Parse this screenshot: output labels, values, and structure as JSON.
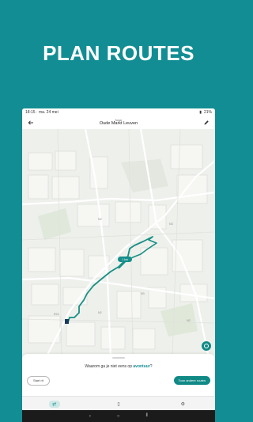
{
  "headline": "PLAN ROUTES",
  "statusbar": {
    "left": "18:15 · ma. 24 mei",
    "right": "21%"
  },
  "appbar": {
    "subtitle": "Naar",
    "title": "Oude Markt Leuven"
  },
  "map": {
    "route_badge": "1 km",
    "labels": [
      "N2",
      "N3",
      "N3",
      "N2",
      "N2",
      "R23"
    ]
  },
  "sheet": {
    "question_prefix": "Waarom ga je niet eens op ",
    "question_accent": "avontuur",
    "question_suffix": "?",
    "start_button": "Start rit",
    "other_routes_button": "Toon andere routes"
  },
  "tabs": [
    {
      "name": "route-tab",
      "icon": "route-icon",
      "active": true
    },
    {
      "name": "saved-tab",
      "icon": "bookmark-icon",
      "active": false
    },
    {
      "name": "settings-tab",
      "icon": "settings-icon",
      "active": false
    }
  ],
  "colors": {
    "background": "#128d93",
    "accent": "#118a86",
    "route": "#168f84"
  }
}
